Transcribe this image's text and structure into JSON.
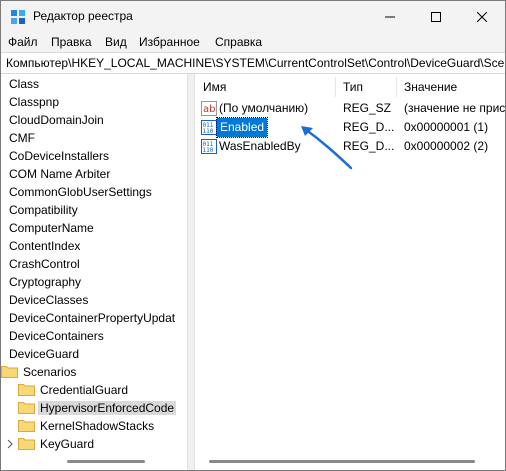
{
  "window": {
    "title": "Редактор реестра"
  },
  "menu": [
    {
      "label": "Файл"
    },
    {
      "label": "Правка"
    },
    {
      "label": "Вид"
    },
    {
      "label": "Избранное"
    },
    {
      "label": "Справка"
    }
  ],
  "address": "Компьютер\\HKEY_LOCAL_MACHINE\\SYSTEM\\CurrentControlSet\\Control\\DeviceGuard\\Scen",
  "tree": {
    "items": [
      {
        "label": "Class"
      },
      {
        "label": "Classpnp"
      },
      {
        "label": "CloudDomainJoin"
      },
      {
        "label": "CMF"
      },
      {
        "label": "CoDeviceInstallers"
      },
      {
        "label": "COM Name Arbiter"
      },
      {
        "label": "CommonGlobUserSettings"
      },
      {
        "label": "Compatibility"
      },
      {
        "label": "ComputerName"
      },
      {
        "label": "ContentIndex"
      },
      {
        "label": "CrashControl"
      },
      {
        "label": "Cryptography"
      },
      {
        "label": "DeviceClasses"
      },
      {
        "label": "DeviceContainerPropertyUpdat"
      },
      {
        "label": "DeviceContainers"
      },
      {
        "label": "DeviceGuard"
      },
      {
        "label": "Scenarios"
      },
      {
        "label": "CredentialGuard"
      },
      {
        "label": "HypervisorEnforcedCode"
      },
      {
        "label": "KernelShadowStacks"
      },
      {
        "label": "KeyGuard"
      }
    ]
  },
  "list": {
    "columns": {
      "name": "Имя",
      "type": "Тип",
      "value": "Значение"
    },
    "rows": [
      {
        "name": "(По умолчанию)",
        "type": "REG_SZ",
        "value": "(значение не прис",
        "icon": "string-value-icon"
      },
      {
        "name": "Enabled",
        "type": "REG_D...",
        "value": "0x00000001 (1)",
        "icon": "dword-value-icon"
      },
      {
        "name": "WasEnabledBy",
        "type": "REG_D...",
        "value": "0x00000002 (2)",
        "icon": "dword-value-icon"
      }
    ]
  },
  "colors": {
    "selection": "#0078d7",
    "arrow": "#1a6fd6",
    "folder": "#f8d775"
  }
}
